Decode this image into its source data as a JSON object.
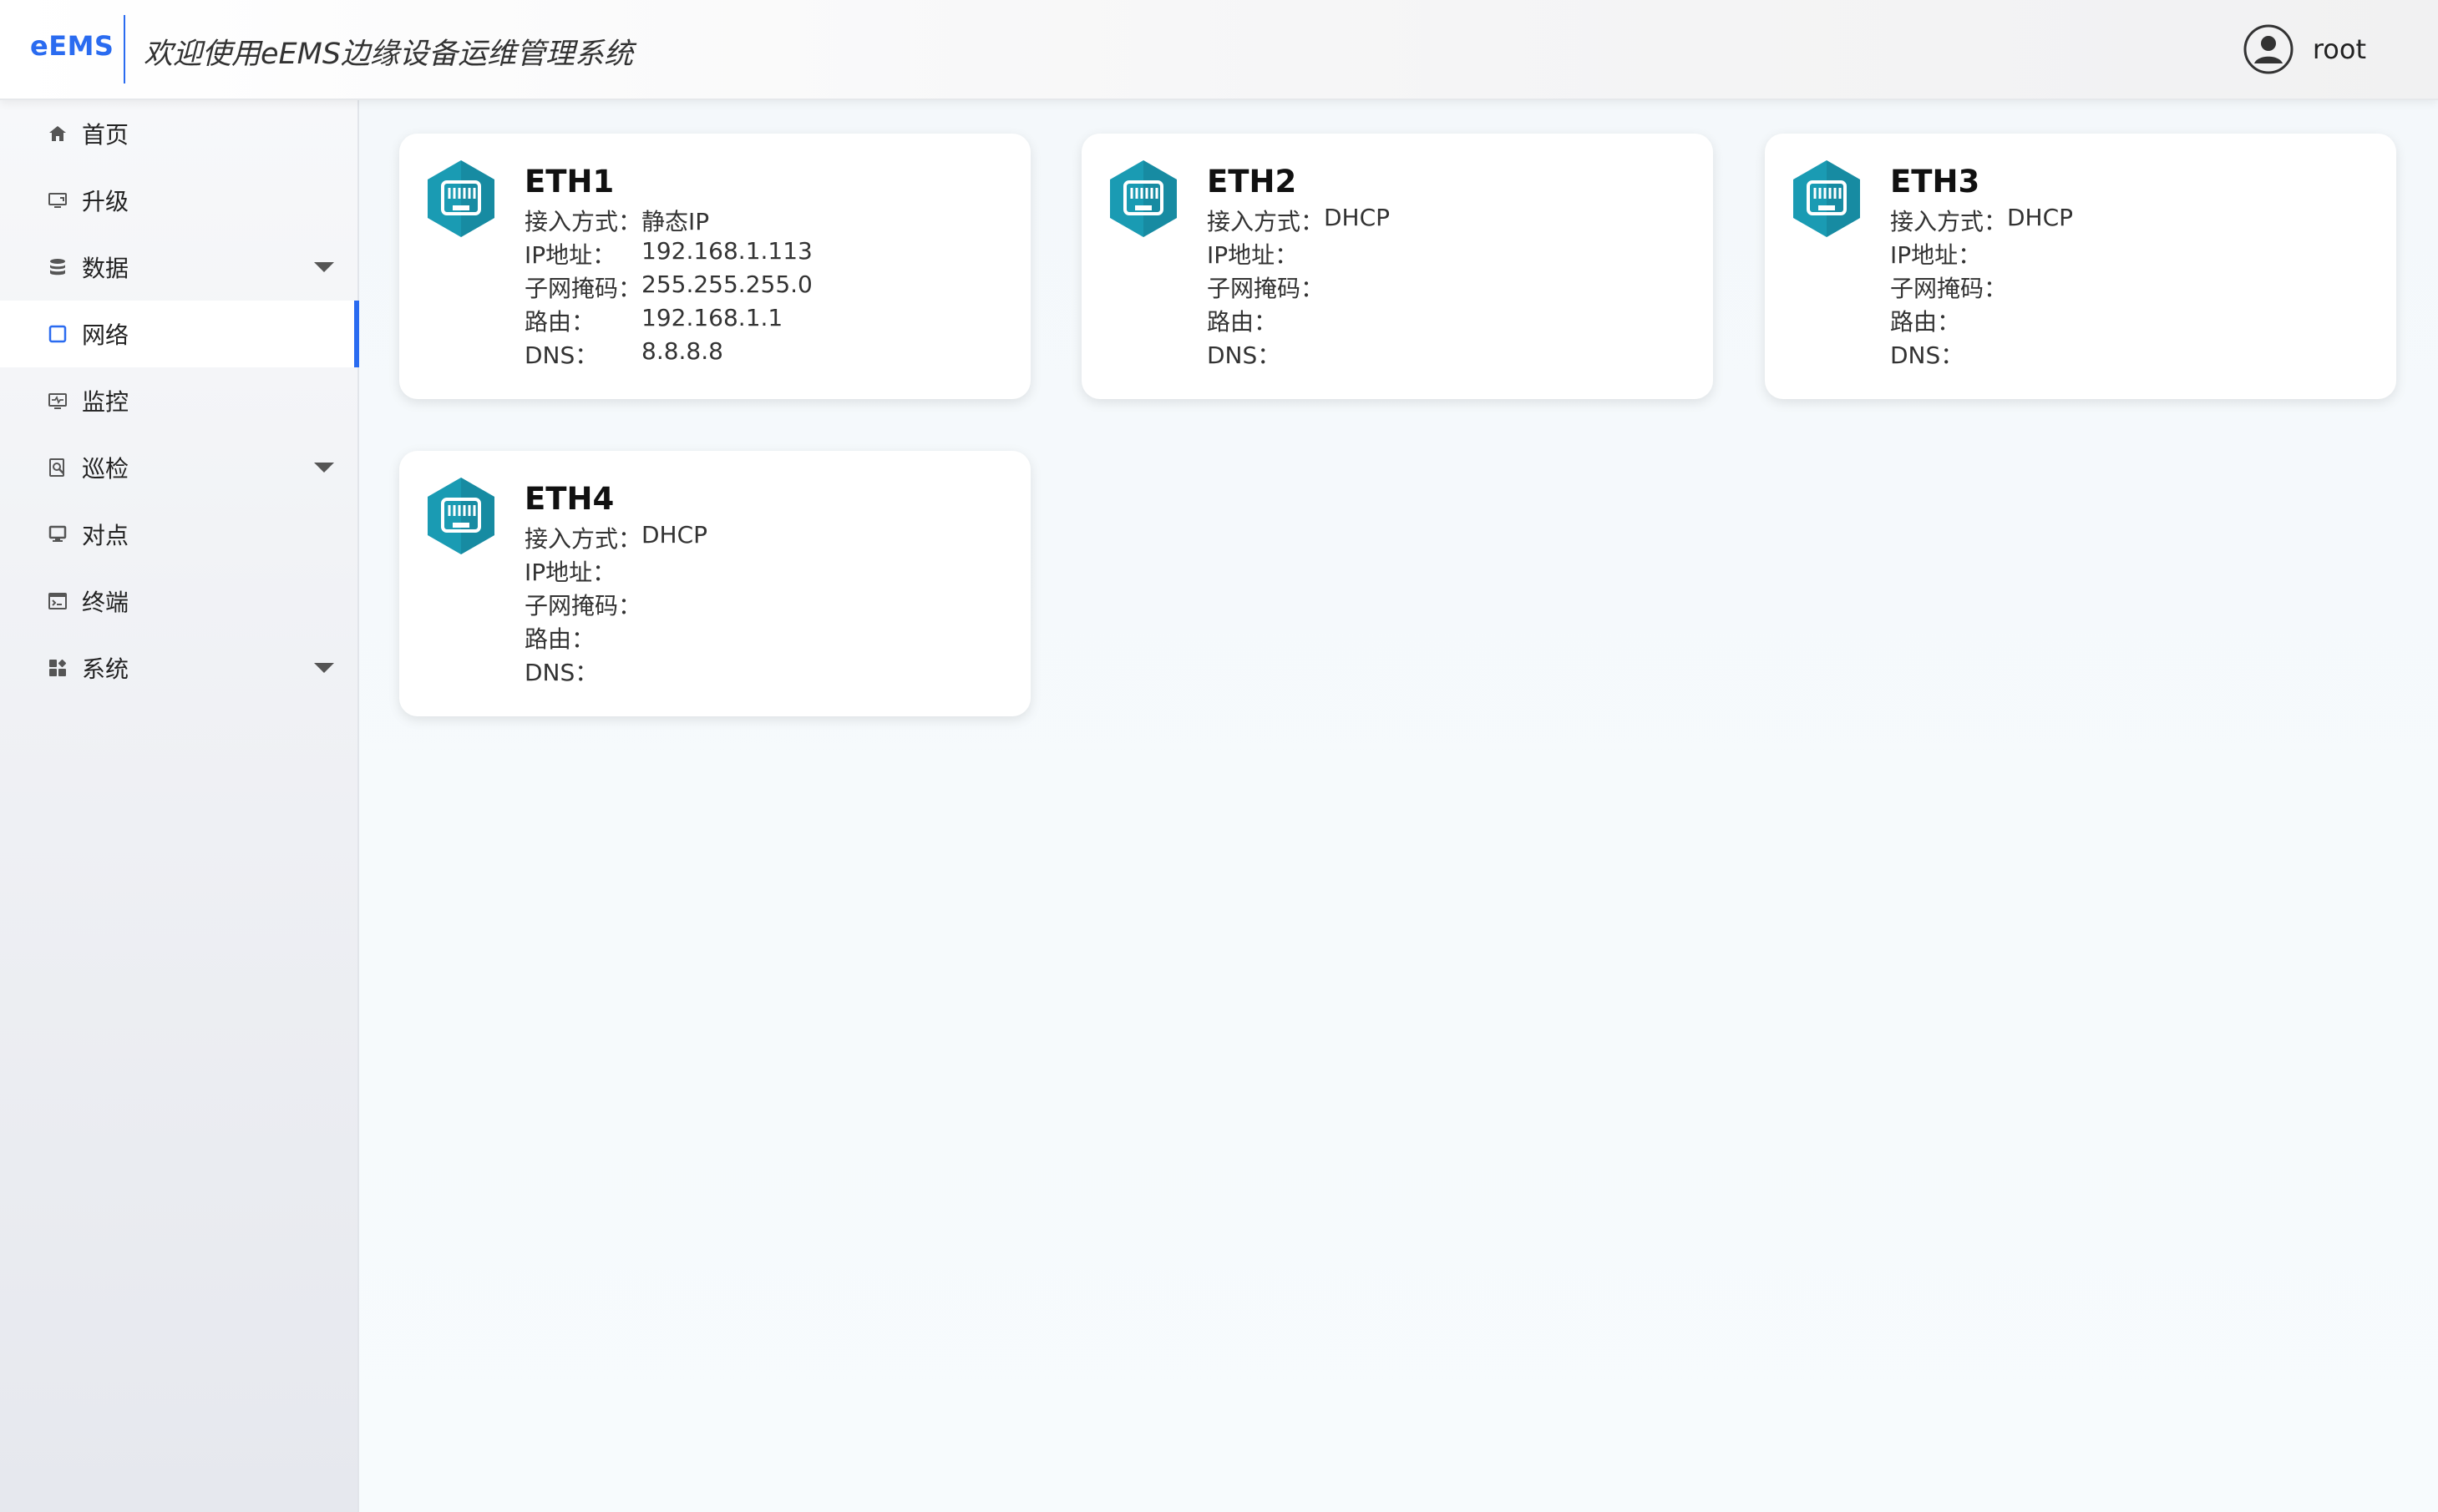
{
  "header": {
    "logo": "eEMS",
    "welcome": "欢迎使用eEMS边缘设备运维管理系统",
    "user_name": "root"
  },
  "sidebar": {
    "items": [
      {
        "label": "首页",
        "icon": "home-icon"
      },
      {
        "label": "升级",
        "icon": "upgrade-icon"
      },
      {
        "label": "数据",
        "icon": "database-icon",
        "expandable": true
      },
      {
        "label": "网络",
        "icon": "network-icon",
        "active": true
      },
      {
        "label": "监控",
        "icon": "monitor-icon"
      },
      {
        "label": "巡检",
        "icon": "inspection-icon",
        "expandable": true
      },
      {
        "label": "对点",
        "icon": "point-icon"
      },
      {
        "label": "终端",
        "icon": "terminal-icon"
      },
      {
        "label": "系统",
        "icon": "system-icon",
        "expandable": true
      }
    ]
  },
  "fields": {
    "mode": "接入方式：",
    "ip": "IP地址：",
    "mask": "子网掩码：",
    "gateway": "路由：",
    "dns": "DNS："
  },
  "cards": [
    {
      "name": "ETH1",
      "mode": "静态IP",
      "ip": "192.168.1.113",
      "mask": "255.255.255.0",
      "gateway": "192.168.1.1",
      "dns": "8.8.8.8"
    },
    {
      "name": "ETH2",
      "mode": "DHCP",
      "ip": "",
      "mask": "",
      "gateway": "",
      "dns": ""
    },
    {
      "name": "ETH3",
      "mode": "DHCP",
      "ip": "",
      "mask": "",
      "gateway": "",
      "dns": ""
    },
    {
      "name": "ETH4",
      "mode": "DHCP",
      "ip": "",
      "mask": "",
      "gateway": "",
      "dns": ""
    }
  ],
  "colors": {
    "accent": "#2a6bf0",
    "card_icon": "#1a9bb3"
  }
}
